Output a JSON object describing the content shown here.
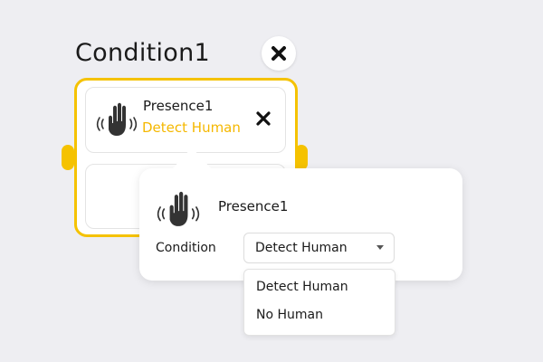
{
  "condition": {
    "title": "Condition1",
    "close_icon": "close-icon"
  },
  "presence_item": {
    "icon": "hand-wave-icon",
    "name": "Presence1",
    "status": "Detect Human",
    "remove_icon": "close-icon"
  },
  "popup": {
    "icon": "hand-wave-icon",
    "name": "Presence1",
    "condition_label": "Condition",
    "selected_value": "Detect Human",
    "options": [
      "Detect Human",
      "No Human"
    ]
  },
  "colors": {
    "accent": "#f5c200",
    "status_text": "#f5b800",
    "background": "#eeeef2"
  }
}
